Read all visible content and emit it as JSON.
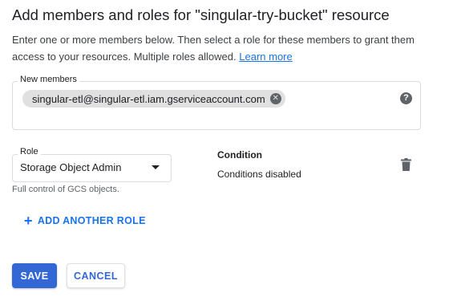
{
  "dialog": {
    "title": "Add members and roles for \"singular-try-bucket\" resource",
    "description": "Enter one or more members below. Then select a role for these members to grant them access to your resources. Multiple roles allowed.",
    "learn_more": "Learn more"
  },
  "members": {
    "label": "New members",
    "chips": [
      "singular-etl@singular-etl.iam.gserviceaccount.com"
    ],
    "chip_remove_icon": "close-circle-icon",
    "help_icon": "help-circle-icon",
    "help_glyph": "?"
  },
  "role": {
    "label": "Role",
    "selected": "Storage Object Admin",
    "hint": "Full control of GCS objects."
  },
  "condition": {
    "title": "Condition",
    "value": "Conditions disabled",
    "delete_icon": "trash-icon"
  },
  "add_role": {
    "label": "ADD ANOTHER ROLE",
    "icon": "plus-icon"
  },
  "actions": {
    "save": "SAVE",
    "cancel": "CANCEL"
  },
  "colors": {
    "accent": "#1a73e8",
    "primary_button": "#3367d6",
    "chip_bg": "#e0e0e0"
  }
}
